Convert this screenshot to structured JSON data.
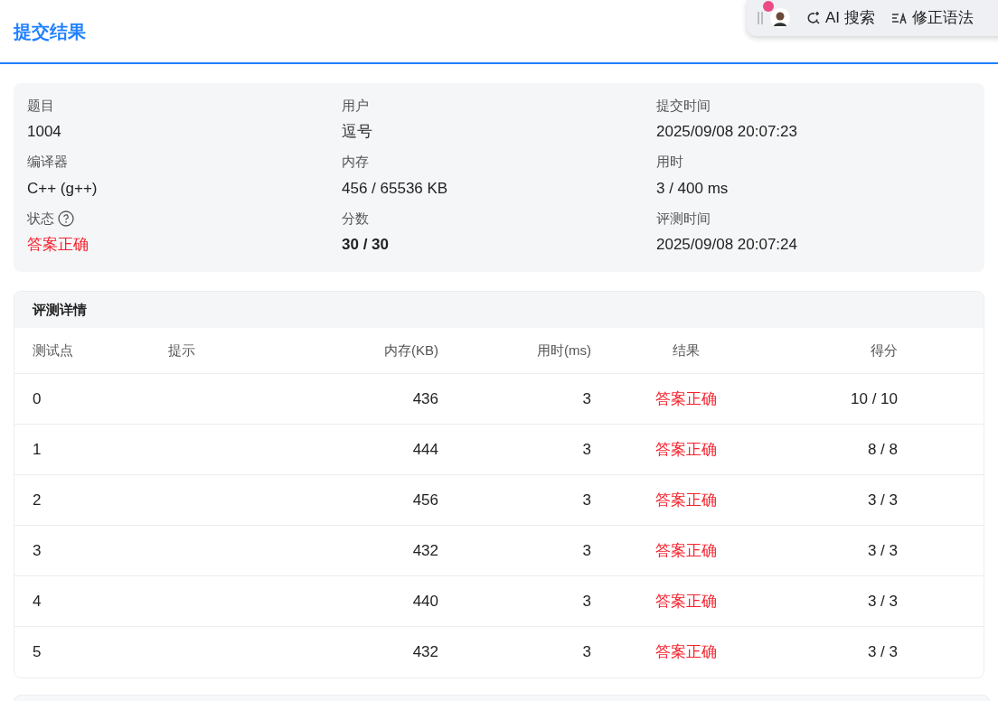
{
  "header": {
    "title": "提交结果"
  },
  "toolbar": {
    "items": [
      {
        "kind": "search",
        "label": "AI 搜索"
      },
      {
        "kind": "grammar",
        "label": "修正语法"
      }
    ]
  },
  "summary": [
    {
      "label": "题目",
      "value": "1004"
    },
    {
      "label": "用户",
      "value": "逗号"
    },
    {
      "label": "提交时间",
      "value": "2025/09/08 20:07:23"
    },
    {
      "label": "编译器",
      "value": "C++ (g++)"
    },
    {
      "label": "内存",
      "value": "456 / 65536 KB"
    },
    {
      "label": "用时",
      "value": "3 / 400 ms"
    },
    {
      "label": "状态",
      "value": "答案正确",
      "kind": "status"
    },
    {
      "label": "分数",
      "value": "30 / 30",
      "kind": "score"
    },
    {
      "label": "评测时间",
      "value": "2025/09/08 20:07:24"
    }
  ],
  "details": {
    "title": "评测详情",
    "columns": [
      "测试点",
      "提示",
      "内存(KB)",
      "用时(ms)",
      "结果",
      "得分"
    ],
    "rows": [
      [
        "0",
        "",
        "436",
        "3",
        "答案正确",
        "10 / 10"
      ],
      [
        "1",
        "",
        "444",
        "3",
        "答案正确",
        "8 / 8"
      ],
      [
        "2",
        "",
        "456",
        "3",
        "答案正确",
        "3 / 3"
      ],
      [
        "3",
        "",
        "432",
        "3",
        "答案正确",
        "3 / 3"
      ],
      [
        "4",
        "",
        "440",
        "3",
        "答案正确",
        "3 / 3"
      ],
      [
        "5",
        "",
        "432",
        "3",
        "答案正确",
        "3 / 3"
      ]
    ]
  }
}
